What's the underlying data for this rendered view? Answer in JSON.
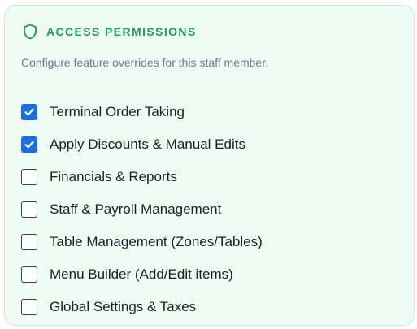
{
  "panel": {
    "icon": "shield-icon",
    "accent_color": "#1f9a5d",
    "title": "ACCESS PERMISSIONS",
    "description": "Configure feature overrides for this staff member."
  },
  "permissions": [
    {
      "label": "Terminal Order Taking",
      "checked": true
    },
    {
      "label": "Apply Discounts & Manual Edits",
      "checked": true
    },
    {
      "label": "Financials & Reports",
      "checked": false
    },
    {
      "label": "Staff & Payroll Management",
      "checked": false
    },
    {
      "label": "Table Management (Zones/Tables)",
      "checked": false
    },
    {
      "label": "Menu Builder (Add/Edit items)",
      "checked": false
    },
    {
      "label": "Global Settings & Taxes",
      "checked": false
    }
  ],
  "checkbox_checked_color": "#1a6fe0"
}
